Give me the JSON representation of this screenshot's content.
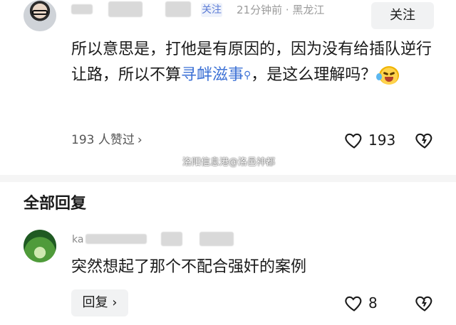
{
  "header": {
    "tag_label": "关注",
    "meta": "21分钟前 · 黑龙江",
    "follow_label": "关注"
  },
  "post": {
    "text_before_link": "所以意思是，打他是有原因的，因为没有给插队逆行让路，所以不算",
    "link_text": "寻衅滋事",
    "text_after_link": "，是这么理解吗？",
    "emoji": "laughing-crying-emoji"
  },
  "likes": {
    "likers_text": "193 人赞过",
    "likers_chevron": "›",
    "like_count": "193"
  },
  "watermark": "洛阳信息港@洛邑神都",
  "section": {
    "title": "全部回复"
  },
  "reply": {
    "name_prefix": "ka",
    "text": "突然想起了那个不配合强奸的案例",
    "reply_button": "回复 ›",
    "like_count": "8"
  },
  "colors": {
    "link": "#3f73d6",
    "meta": "#9b9b9b",
    "button_bg": "#f1f2f3"
  }
}
